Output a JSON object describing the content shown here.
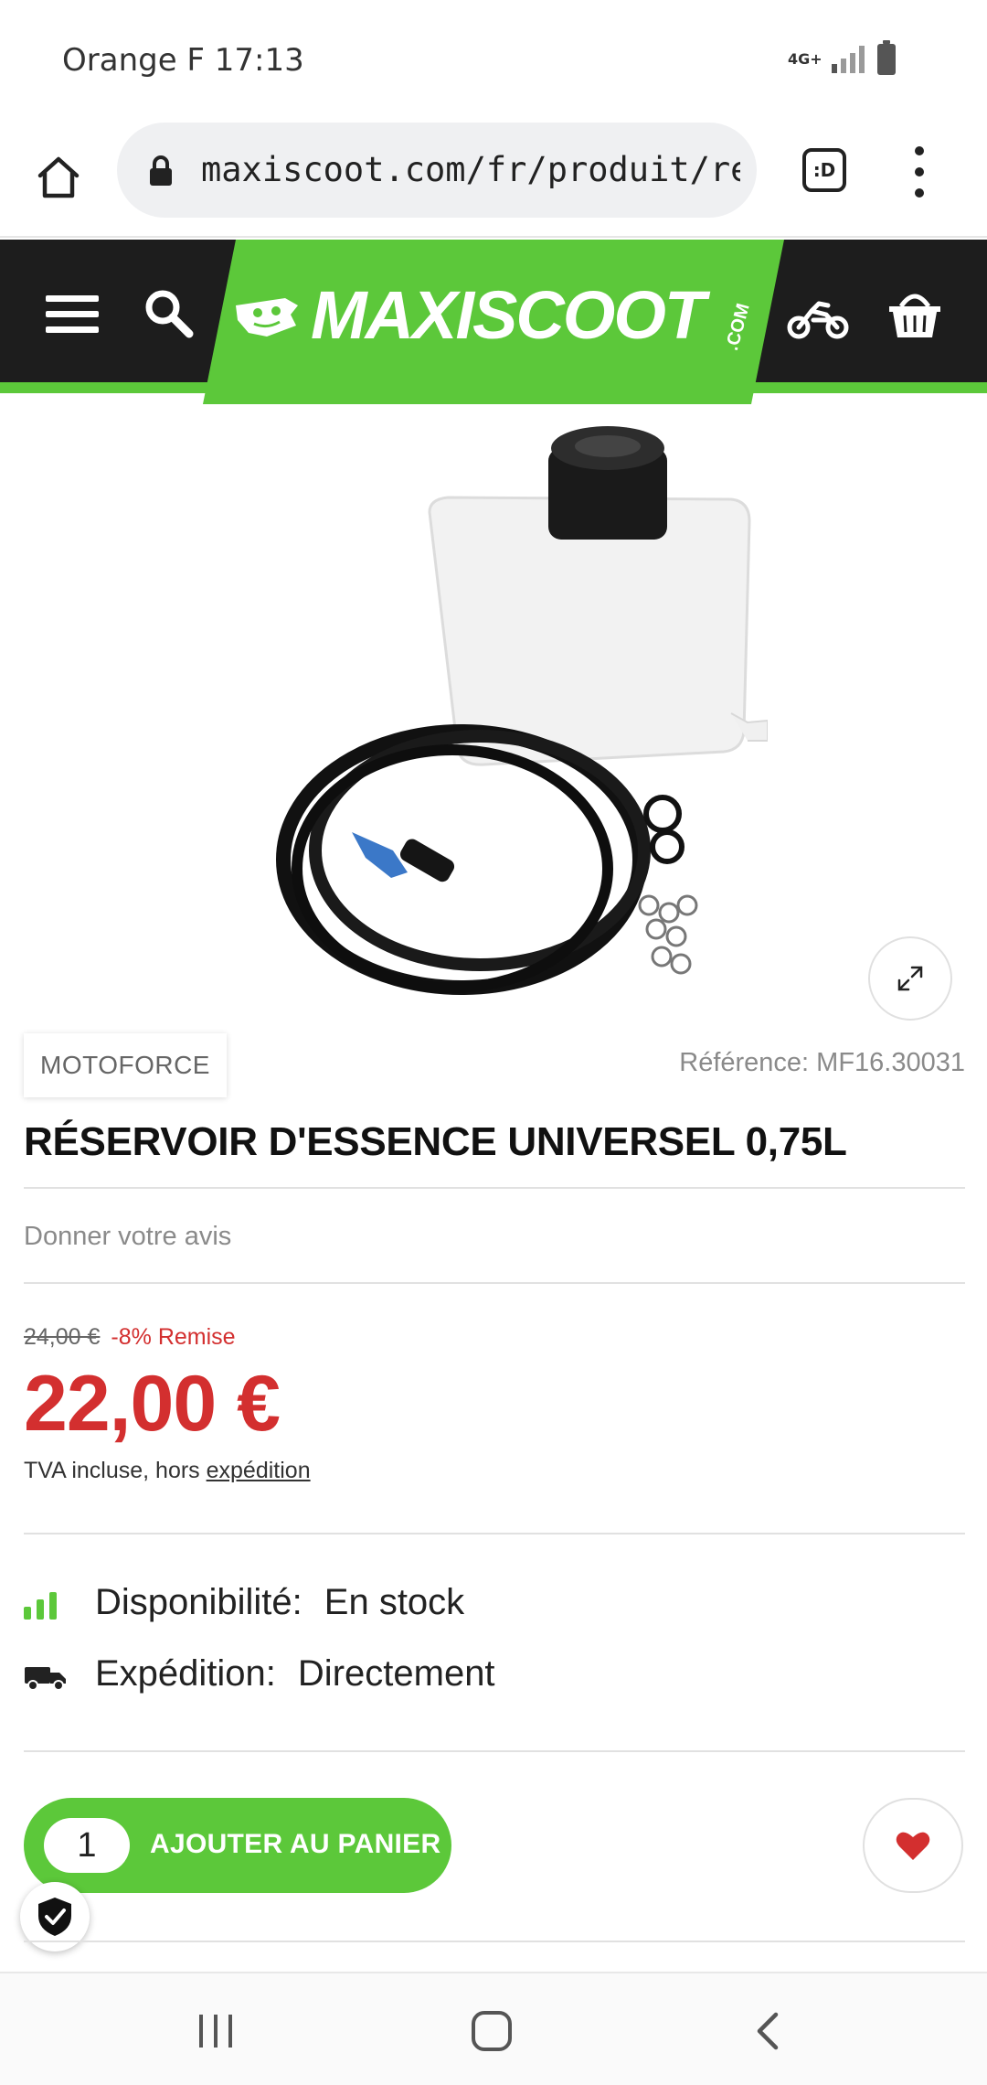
{
  "status_bar": {
    "carrier_time": "Orange F 17:13",
    "network": "4G+"
  },
  "browser": {
    "url": "maxiscoot.com/fr/produit/rese",
    "tab_icon_label": ":D"
  },
  "site": {
    "logo_text": "MAXISCOOT",
    "logo_suffix": ".COM",
    "brand_color": "#5cc83a",
    "header_color": "#1d1d1d"
  },
  "product": {
    "brand": "MOTOFORCE",
    "reference": "Référence: MF16.30031",
    "title": "RÉSERVOIR D'ESSENCE UNIVERSEL 0,75L",
    "review_link": "Donner votre avis",
    "old_price": "24,00 €",
    "discount": "-8% Remise",
    "price": "22,00 €",
    "tax_text": "TVA incluse, hors ",
    "tax_link": "expédition",
    "availability_label": "Disponibilité:",
    "availability_value": "En stock",
    "shipping_label": "Expédition:",
    "shipping_value": "Directement",
    "price_color": "#d32f2f"
  },
  "cart": {
    "quantity": "1",
    "add_to_cart_label": "AJOUTER AU PANIER"
  },
  "icons": {
    "header": [
      "menu-icon",
      "search-icon",
      "motorbike-icon",
      "basket-icon"
    ],
    "browser": [
      "home-icon",
      "lock-icon",
      "tabs-icon",
      "more-vert-icon"
    ],
    "android_nav": [
      "recents-icon",
      "home-icon",
      "back-icon"
    ]
  }
}
